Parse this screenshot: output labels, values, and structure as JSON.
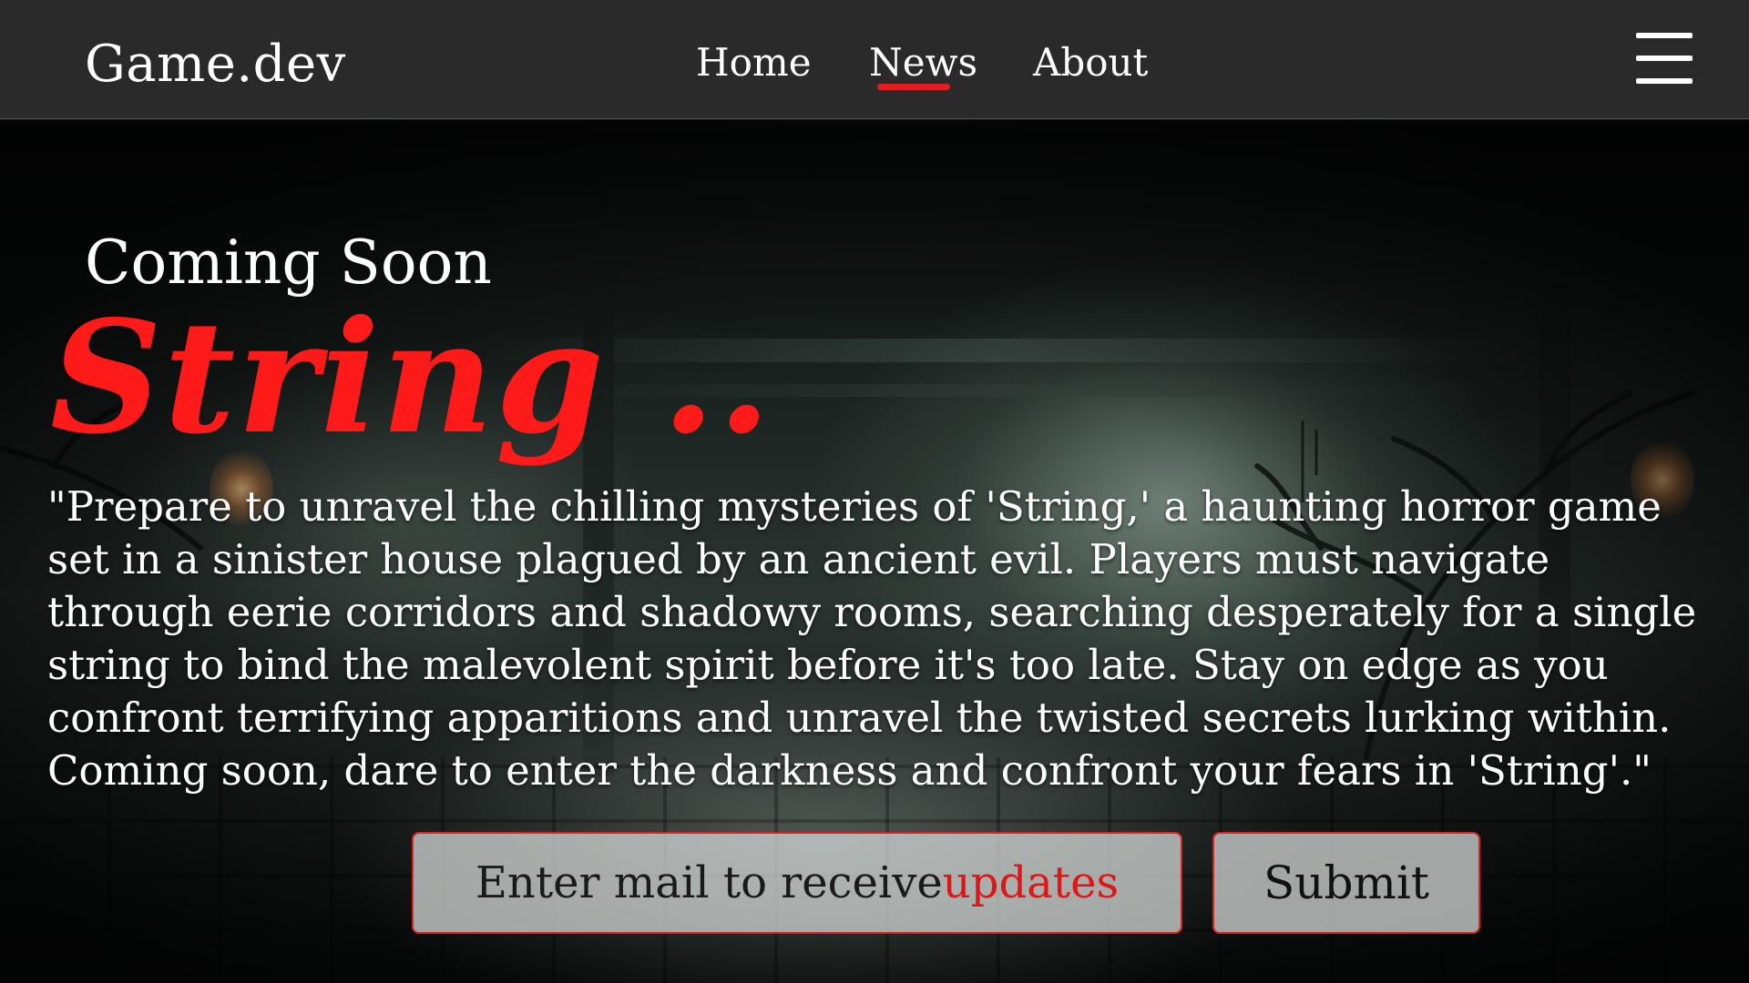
{
  "header": {
    "brand": "Game.dev",
    "nav": {
      "home": "Home",
      "news": "News",
      "about": "About"
    },
    "active_nav": "News",
    "menu_icon": "hamburger-menu-icon",
    "accent_color": "#e41e1e"
  },
  "hero": {
    "eyebrow": "Coming Soon",
    "title": "String ..",
    "title_color": "#ff1a1a",
    "description": "\"Prepare to unravel the chilling mysteries of 'String,' a haunting horror game set in a sinister house plagued by an ancient evil. Players must navigate through eerie corridors and shadowy rooms, searching desperately for a single string to bind the malevolent spirit before it's too late. Stay on edge as you confront terrifying apparitions and unravel the twisted secrets lurking within. Coming soon, dare to enter the darkness and confront your fears in 'String'.\""
  },
  "signup": {
    "placeholder_main": "Enter mail to receive ",
    "placeholder_accent": "updates",
    "submit_label": "Submit"
  }
}
